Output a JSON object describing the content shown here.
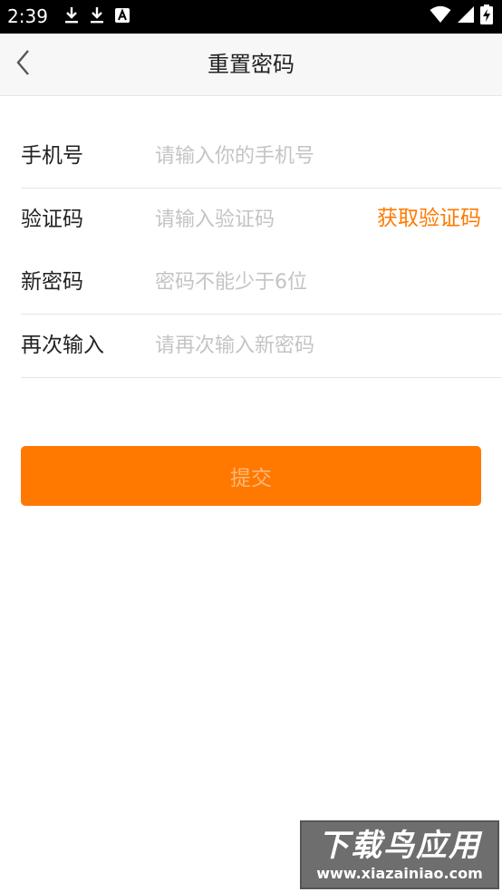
{
  "status_bar": {
    "time": "2:39",
    "left_icons": [
      "download-icon",
      "download-icon",
      "keyboard-a-icon"
    ],
    "right_icons": [
      "wifi-icon",
      "signal-icon",
      "battery-charging-icon"
    ]
  },
  "toolbar": {
    "title": "重置密码",
    "back_icon": "chevron-left-icon"
  },
  "form": {
    "phone": {
      "label": "手机号",
      "placeholder": "请输入你的手机号",
      "value": ""
    },
    "code": {
      "label": "验证码",
      "placeholder": "请输入验证码",
      "value": "",
      "get_code_label": "获取验证码"
    },
    "new_password": {
      "label": "新密码",
      "placeholder": "密码不能少于6位",
      "value": ""
    },
    "confirm_password": {
      "label": "再次输入",
      "placeholder": "请再次输入新密码",
      "value": ""
    }
  },
  "submit": {
    "label": "提交"
  },
  "watermark": {
    "title": "下载鸟应用",
    "url": "www.xiazainiao.com"
  },
  "colors": {
    "accent": "#ff7800",
    "link": "#ff7a00",
    "submit_text": "#ffb878",
    "toolbar_bg": "#f7f7f7",
    "divider": "#e6e6e6",
    "placeholder": "#c4c4c4"
  }
}
